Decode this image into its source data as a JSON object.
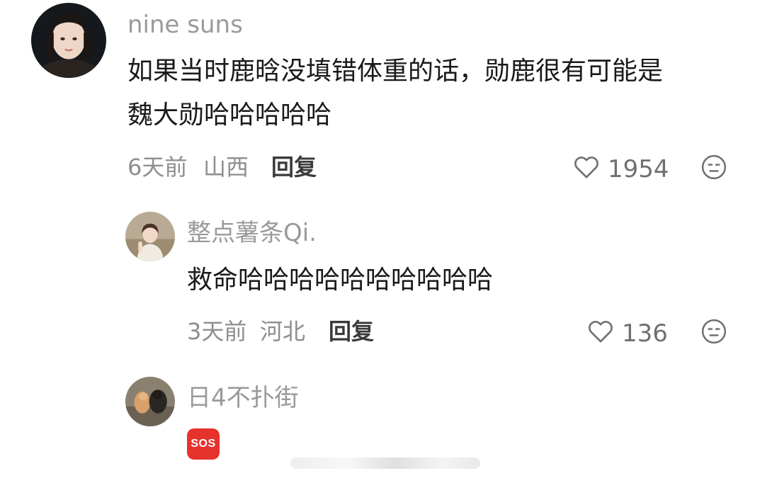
{
  "comments": [
    {
      "username": "nine suns",
      "text_line1": "如果当时鹿晗没填错体重的话，勋鹿很有可能是",
      "text_line2": "魏大勋哈哈哈哈哈",
      "time": "6天前",
      "location": "山西",
      "reply_label": "回复",
      "likes": "1954"
    },
    {
      "username": "整点薯条Qi.",
      "text_line1": "救命哈哈哈哈哈哈哈哈哈哈",
      "time": "3天前",
      "location": "河北",
      "reply_label": "回复",
      "likes": "136"
    },
    {
      "username": "日4不扑街",
      "sticker_text": "SOS"
    }
  ],
  "colors": {
    "username": "#9a9a9a",
    "text": "#1a1a1a",
    "meta": "#8e8e8e",
    "icon": "#707070",
    "sos": "#e6322d"
  }
}
